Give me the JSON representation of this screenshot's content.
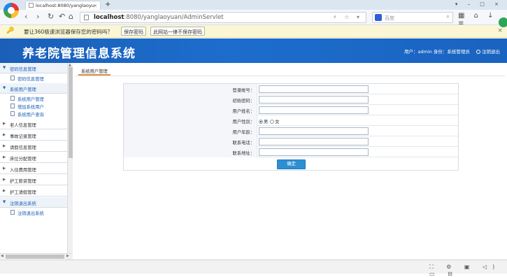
{
  "browser": {
    "tab_title": "localhost:8080/yanglaoyu",
    "tab_close": "×",
    "new_tab": "+",
    "window_controls": "▾ – □ ×",
    "address_host": "localhost",
    "address_path": ":8080/yanglaoyuan/AdminServlet",
    "address_right_icons": "⚡ ☆ ▾",
    "search_placeholder": "百度",
    "search_glyph": "⌕",
    "nav_back": "‹",
    "nav_forward": "›",
    "nav_refresh": "↻",
    "nav_undo": "↶",
    "nav_home": "⌂",
    "toolbar_right_icons": "▦ ⌂ ↓ ≡"
  },
  "save_password_bar": {
    "message": "要让360极速浏览器保存您的密码吗？",
    "save_button": "保存密码",
    "never_button": "此网站一律不保存密码",
    "close": "×",
    "key_icon": "key-icon"
  },
  "header": {
    "title": "养老院管理信息系统",
    "user_info": "用户：admin 身份：系统管理员",
    "logout": "注销退出"
  },
  "sidebar": {
    "groups": [
      {
        "label": "密码信息管理",
        "open": true,
        "items": [
          "密码信息管理"
        ]
      },
      {
        "label": "系统用户管理",
        "open": true,
        "items": [
          "系统用户管理",
          "增加系统用户",
          "系统用户查询"
        ]
      },
      {
        "label": "老人信息管理",
        "open": false
      },
      {
        "label": "事故记录管理",
        "open": false
      },
      {
        "label": "请假信息管理",
        "open": false
      },
      {
        "label": "床位分配管理",
        "open": false
      },
      {
        "label": "入住费用管理",
        "open": false
      },
      {
        "label": "护工薪资管理",
        "open": false
      },
      {
        "label": "护工请假管理",
        "open": false
      },
      {
        "label": "注销退出系统",
        "open": true,
        "items": [
          "注销退出系统"
        ]
      }
    ],
    "arrow_open": "▼",
    "arrow_closed": "▶"
  },
  "content": {
    "tab_label": "系统用户管理",
    "form": {
      "fields": [
        {
          "label": "登录帐号：",
          "value": ""
        },
        {
          "label": "初始密码：",
          "value": ""
        },
        {
          "label": "用户姓名：",
          "value": ""
        },
        {
          "label": "用户性别：",
          "type": "radio",
          "options": [
            "男",
            "女"
          ],
          "selected": "男"
        },
        {
          "label": "用户年龄：",
          "value": ""
        },
        {
          "label": "联系电话：",
          "value": ""
        },
        {
          "label": "联系地址：",
          "value": ""
        }
      ],
      "submit": "确定"
    }
  },
  "scroll": {
    "up": "▲",
    "down": "▼",
    "left": "◀",
    "right": "▶"
  },
  "statusbar": {
    "icons": "⛶ ⚙ ▣ ◁) ▭ ⊟"
  }
}
